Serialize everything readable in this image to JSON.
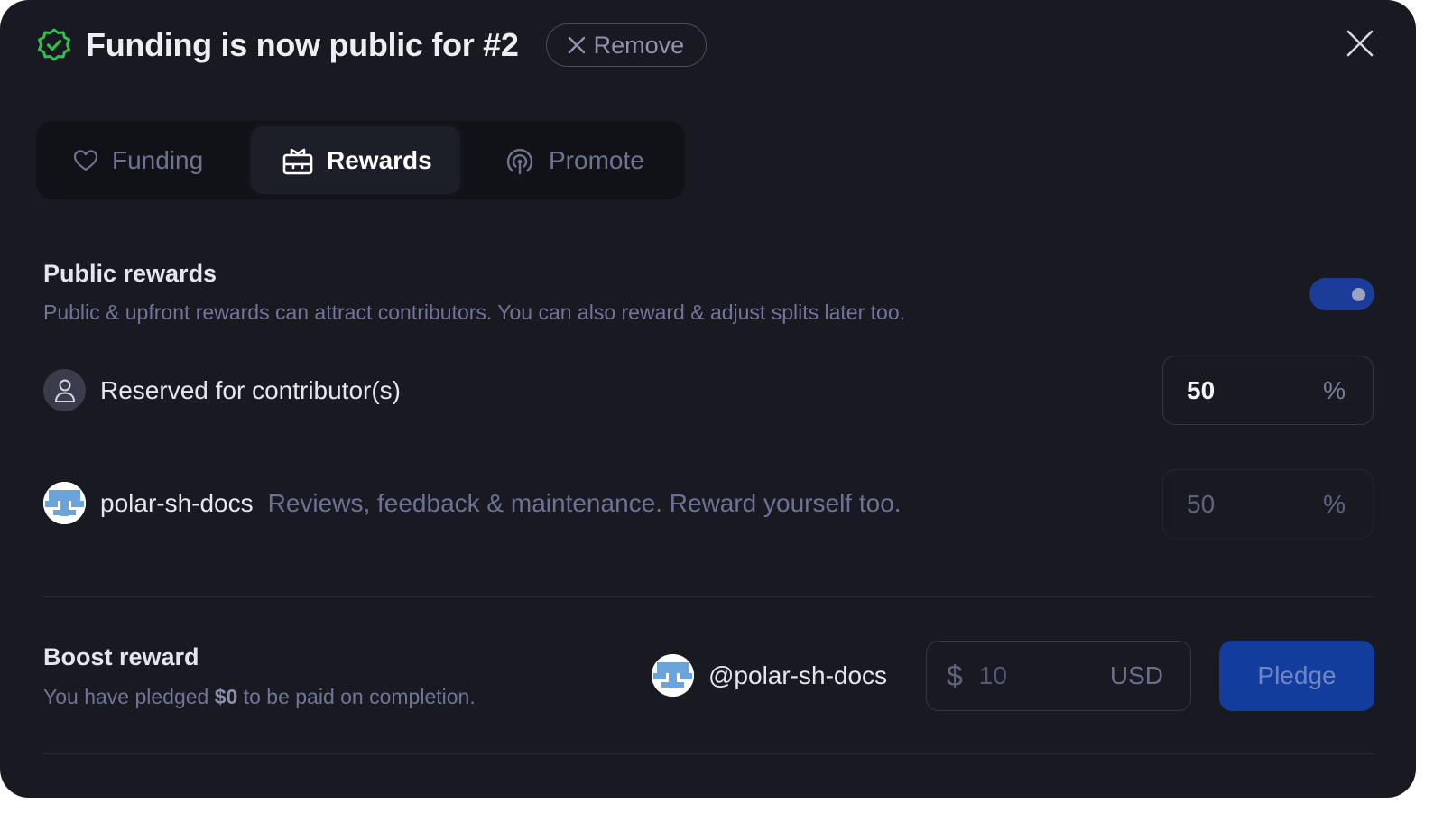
{
  "header": {
    "title": "Funding is now public for #2",
    "remove_label": "Remove"
  },
  "tabs": [
    {
      "label": "Funding",
      "icon": "heart-icon",
      "active": false
    },
    {
      "label": "Rewards",
      "icon": "gift-icon",
      "active": true
    },
    {
      "label": "Promote",
      "icon": "broadcast-icon",
      "active": false
    }
  ],
  "public_rewards": {
    "title": "Public rewards",
    "description": "Public & upfront rewards can attract contributors. You can also reward & adjust splits later too.",
    "enabled": true
  },
  "splits": [
    {
      "label": "Reserved for contributor(s)",
      "hint": "",
      "value": "50",
      "unit": "%"
    },
    {
      "label": "polar-sh-docs",
      "hint": "Reviews, feedback & maintenance. Reward yourself too.",
      "value": "50",
      "unit": "%"
    }
  ],
  "boost": {
    "title": "Boost reward",
    "desc_prefix": "You have pledged",
    "pledged": "$0",
    "desc_suffix": "to be paid on completion.",
    "pledger": "@polar-sh-docs",
    "currency_symbol": "$",
    "amount_placeholder": "10",
    "currency": "USD",
    "pledge_label": "Pledge"
  },
  "colors": {
    "background": "#191a21",
    "accent": "#1b3d99",
    "success": "#22c55e"
  }
}
